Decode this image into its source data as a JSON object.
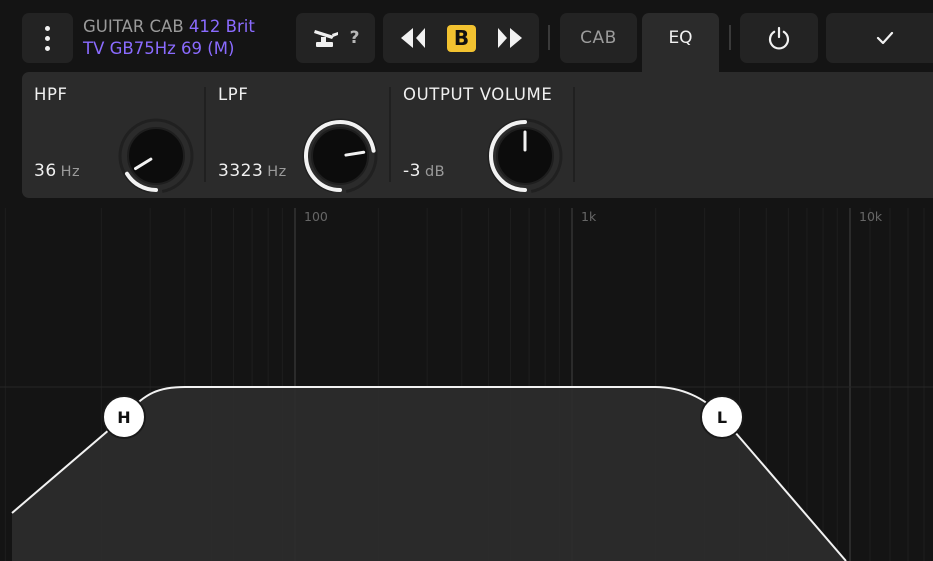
{
  "toolbar": {
    "menu_icon": "vertical-dots-icon",
    "title_category": "GUITAR CAB",
    "title_model_line1": "412 Brit",
    "title_model_line2": "TV GB75Hz 69 (M)",
    "footswitch_icon": "footswitch-icon",
    "footswitch_hint": "?",
    "prev_icon": "previous-icon",
    "ab_label": "B",
    "next_icon": "next-icon",
    "tabs": [
      {
        "label": "CAB",
        "active": false
      },
      {
        "label": "EQ",
        "active": true
      }
    ],
    "power_icon": "power-icon",
    "confirm_icon": "checkmark-icon"
  },
  "params": [
    {
      "label": "HPF",
      "value": "36",
      "unit": "Hz",
      "knob_fraction": 0.05
    },
    {
      "label": "LPF",
      "value": "3323",
      "unit": "Hz",
      "knob_fraction": 0.8
    },
    {
      "label": "OUTPUT VOLUME",
      "value": "-3",
      "unit": "dB",
      "knob_fraction": 0.5
    }
  ],
  "eq_graph": {
    "freq_labels": [
      "100",
      "1k",
      "10k"
    ],
    "nodes": [
      {
        "label": "H",
        "name": "hpf-node"
      },
      {
        "label": "L",
        "name": "lpf-node"
      }
    ]
  },
  "colors": {
    "accent_purple": "#8a6bff",
    "ab_yellow": "#f2c230",
    "panel": "#2b2b2b",
    "background": "#141414"
  }
}
